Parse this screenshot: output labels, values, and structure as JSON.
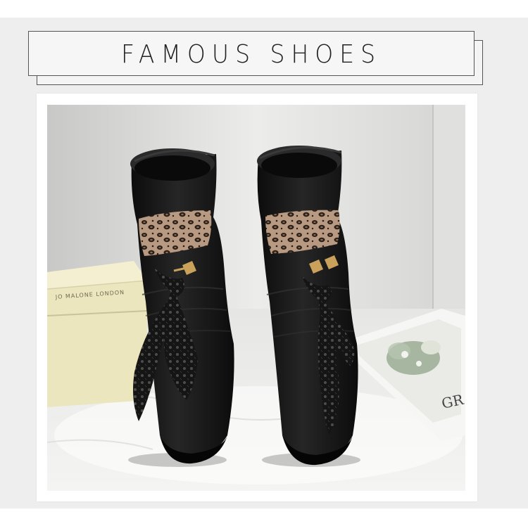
{
  "banner": {
    "title": "FAMOUS SHOES"
  },
  "product_photo": {
    "box_brand_text": "JO MALONE LONDON",
    "card_text": "GR",
    "colors": {
      "boot": "#141414",
      "leopard_base": "#b89a82",
      "lace": "#1a1a1a",
      "zipper": "#c9a15a",
      "background": "#dcdcdc",
      "box": "#ece6bf"
    }
  }
}
